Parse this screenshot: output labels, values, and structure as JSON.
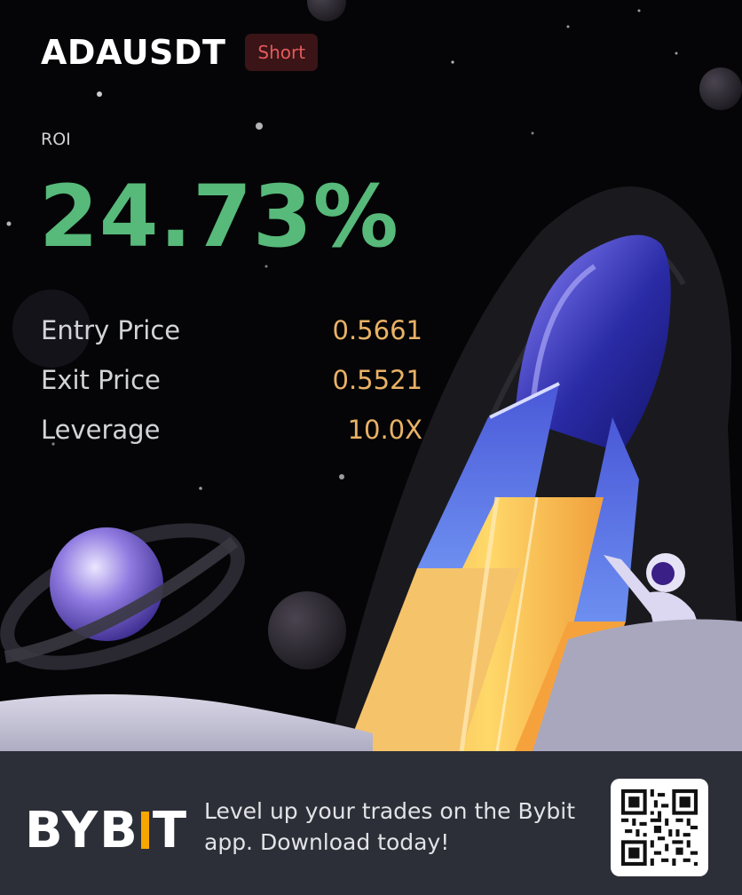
{
  "position": {
    "pair": "ADAUSDT",
    "side": "Short",
    "side_color": "#e35a5a"
  },
  "roi": {
    "label": "ROI",
    "value": "24.73%",
    "color": "#57b97a"
  },
  "stats": [
    {
      "label": "Entry Price",
      "value": "0.5661"
    },
    {
      "label": "Exit Price",
      "value": "0.5521"
    },
    {
      "label": "Leverage",
      "value": "10.0X"
    }
  ],
  "footer": {
    "logo": {
      "text_left": "BYB",
      "text_right": "T",
      "accent_color": "#f7a600"
    },
    "tagline_line1": "Level up your trades on the Bybit",
    "tagline_line2": "app. Download today!"
  },
  "illustration": {
    "elements": [
      "rocket-illustration",
      "ringed-planet",
      "astronaut",
      "moon-surface",
      "stars"
    ]
  }
}
